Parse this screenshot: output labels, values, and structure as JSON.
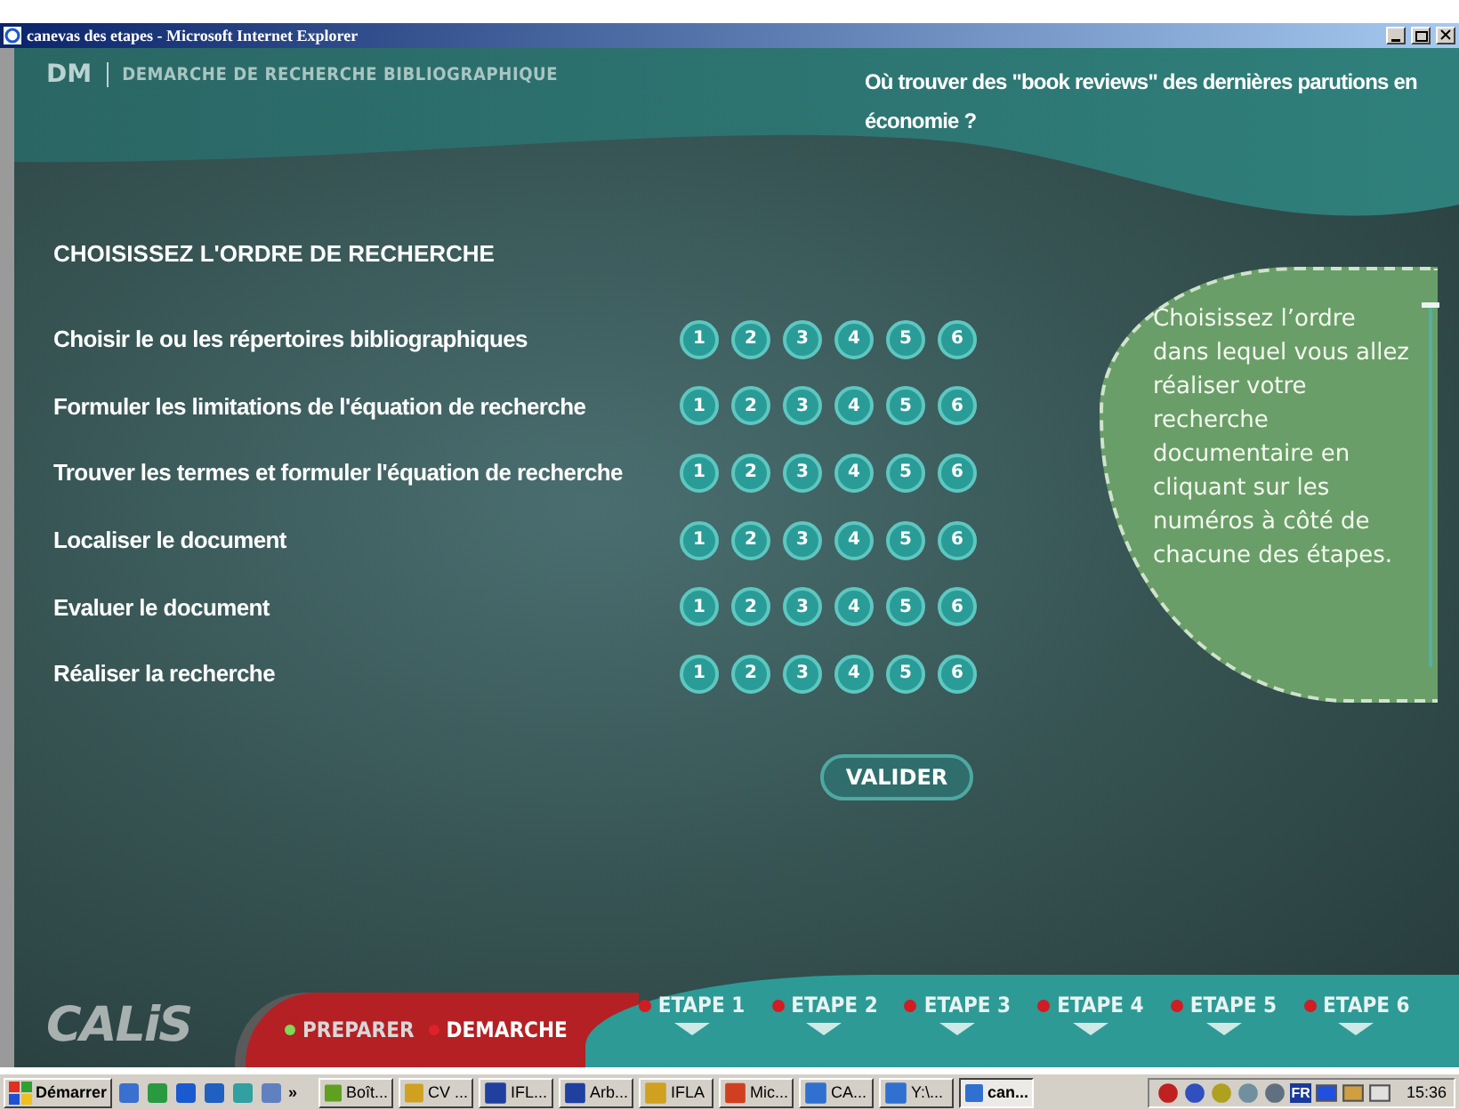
{
  "window": {
    "title": "canevas des etapes - Microsoft Internet Explorer"
  },
  "header": {
    "code": "DM",
    "section": "DEMARCHE DE RECHERCHE BIBLIOGRAPHIQUE",
    "question": "Où trouver des \"book reviews\" des dernières parutions en économie ?"
  },
  "task": {
    "heading": "CHOISISSEZ L'ORDRE DE RECHERCHE",
    "steps": [
      {
        "label": "Choisir le ou les répertoires bibliographiques",
        "numbers": [
          {
            "label": "1",
            "selected": false
          },
          {
            "label": "2",
            "selected": false
          },
          {
            "label": "3",
            "selected": false
          },
          {
            "label": "4",
            "selected": false
          },
          {
            "label": "5",
            "selected": false
          },
          {
            "label": "6",
            "selected": false
          }
        ]
      },
      {
        "label": "Formuler les limitations de l'équation de recherche",
        "numbers": [
          {
            "label": "1",
            "selected": false
          },
          {
            "label": "2",
            "selected": false
          },
          {
            "label": "3",
            "selected": false
          },
          {
            "label": "4",
            "selected": false
          },
          {
            "label": "5",
            "selected": false
          },
          {
            "label": "6",
            "selected": false
          }
        ]
      },
      {
        "label": "Trouver les termes et formuler l'équation de recherche",
        "numbers": [
          {
            "label": "1",
            "selected": false
          },
          {
            "label": "2",
            "selected": false
          },
          {
            "label": "3",
            "selected": false
          },
          {
            "label": "4",
            "selected": false
          },
          {
            "label": "5",
            "selected": false
          },
          {
            "label": "6",
            "selected": false
          }
        ]
      },
      {
        "label": "Localiser le document",
        "numbers": [
          {
            "label": "1",
            "selected": false
          },
          {
            "label": "2",
            "selected": false
          },
          {
            "label": "3",
            "selected": false
          },
          {
            "label": "4",
            "selected": false
          },
          {
            "label": "5",
            "selected": false
          },
          {
            "label": "6",
            "selected": false
          }
        ]
      },
      {
        "label": "Evaluer le document",
        "numbers": [
          {
            "label": "1",
            "selected": false
          },
          {
            "label": "2",
            "selected": false
          },
          {
            "label": "3",
            "selected": false
          },
          {
            "label": "4",
            "selected": false
          },
          {
            "label": "5",
            "selected": false
          },
          {
            "label": "6",
            "selected": false
          }
        ]
      },
      {
        "label": "Réaliser la recherche",
        "numbers": [
          {
            "label": "1",
            "selected": false
          },
          {
            "label": "2",
            "selected": false
          },
          {
            "label": "3",
            "selected": false
          },
          {
            "label": "4",
            "selected": false
          },
          {
            "label": "5",
            "selected": false
          },
          {
            "label": "6",
            "selected": false
          }
        ]
      }
    ],
    "validate_button": "VALIDER"
  },
  "help": {
    "text": "Choisissez l’ordre dans lequel vous allez réaliser votre recherche documentaire en cliquant sur les numéros à côté de chacune des étapes."
  },
  "footer": {
    "logo": "CALiS",
    "phases": [
      {
        "label": "PREPARER",
        "current": false,
        "color": "#7ed957"
      },
      {
        "label": "DEMARCHE",
        "current": true,
        "color": "#e0202a"
      }
    ],
    "etapes": [
      {
        "label": "ETAPE 1"
      },
      {
        "label": "ETAPE 2"
      },
      {
        "label": "ETAPE 3"
      },
      {
        "label": "ETAPE 4"
      },
      {
        "label": "ETAPE 5"
      },
      {
        "label": "ETAPE 6"
      }
    ]
  },
  "taskbar": {
    "start": "Démarrer",
    "more": "»",
    "tasks": [
      {
        "label": "Boît...",
        "selected": false
      },
      {
        "label": "CV ...",
        "selected": false
      },
      {
        "label": "IFL...",
        "selected": false
      },
      {
        "label": "Arb...",
        "selected": false
      },
      {
        "label": "IFLA",
        "selected": false
      },
      {
        "label": "Mic...",
        "selected": false
      },
      {
        "label": "CA...",
        "selected": false
      },
      {
        "label": "Y:\\...",
        "selected": false
      },
      {
        "label": "can...",
        "selected": true
      }
    ],
    "language": "FR",
    "clock": "15:36"
  }
}
